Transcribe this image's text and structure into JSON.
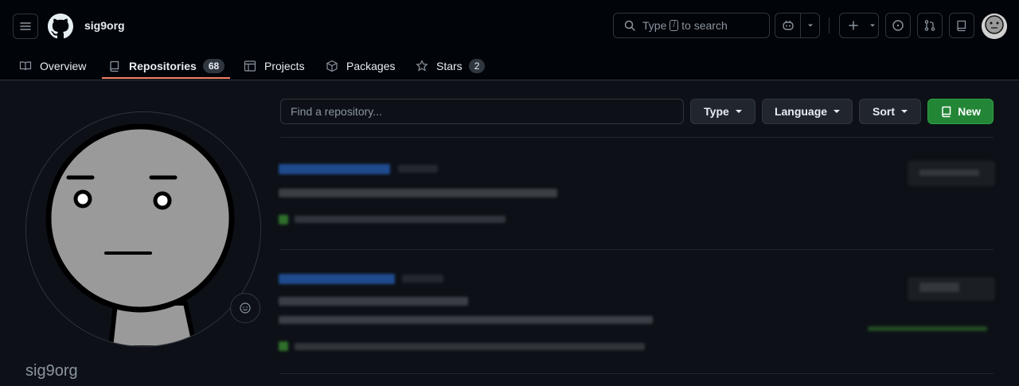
{
  "header": {
    "owner": "sig9org",
    "search": {
      "prefix": "Type",
      "key": "/",
      "suffix": "to search"
    }
  },
  "tabs": [
    {
      "label": "Overview"
    },
    {
      "label": "Repositories",
      "count": "68",
      "active": true
    },
    {
      "label": "Projects"
    },
    {
      "label": "Packages"
    },
    {
      "label": "Stars",
      "count": "2"
    }
  ],
  "sidebar": {
    "name": "sig9org"
  },
  "filters": {
    "find_placeholder": "Find a repository...",
    "type_label": "Type",
    "language_label": "Language",
    "sort_label": "Sort",
    "new_label": "New"
  },
  "colors": {
    "accent_underline": "#f78166",
    "new_button": "#238636",
    "link": "#4493f8"
  }
}
